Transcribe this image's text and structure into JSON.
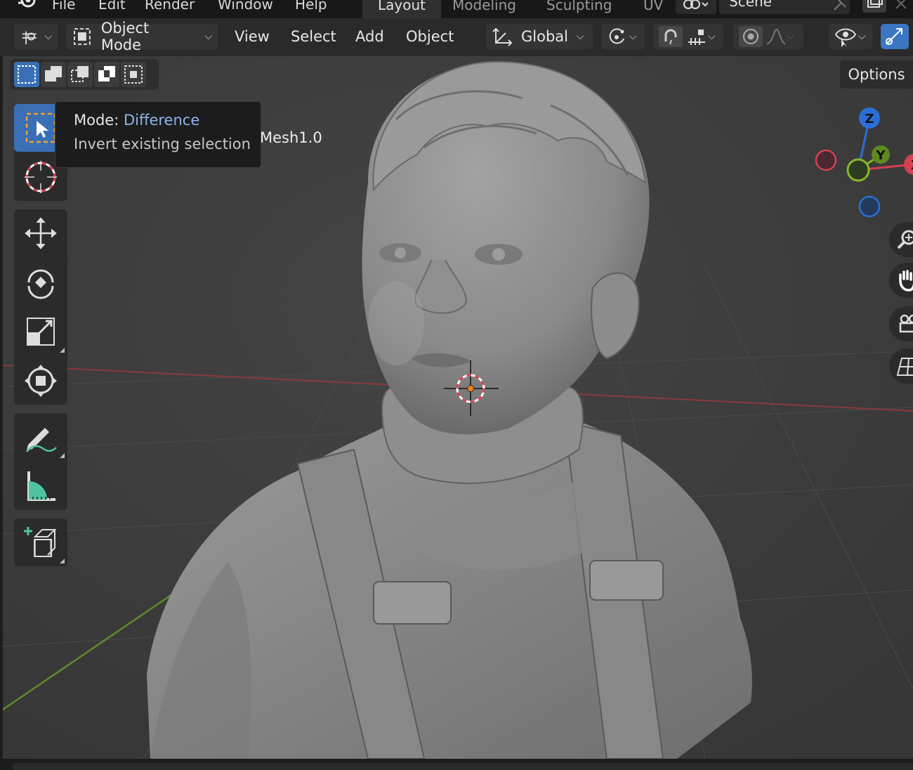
{
  "menus": [
    "File",
    "Edit",
    "Render",
    "Window",
    "Help"
  ],
  "workspaces": [
    "Layout",
    "Modeling",
    "Sculpting",
    "UV"
  ],
  "active_workspace": "Layout",
  "scene_name": "Scene",
  "header": {
    "mode_label": "Object Mode",
    "menu_view": "View",
    "menu_select": "Select",
    "menu_add": "Add",
    "menu_object": "Object",
    "orientation_label": "Global"
  },
  "tooltip": {
    "key": "Mode:",
    "value": "Difference",
    "description": "Invert existing selection"
  },
  "object_label": "Mesh1.0",
  "options_label": "Options",
  "gizmo": {
    "z": "Z",
    "y": "Y",
    "x": "X"
  },
  "colors": {
    "accent": "#3a76c2",
    "x_axis": "#d5414f",
    "y_axis": "#86b72a",
    "z_axis": "#2a6fd6",
    "tooltip_value": "#8fb3ea"
  }
}
